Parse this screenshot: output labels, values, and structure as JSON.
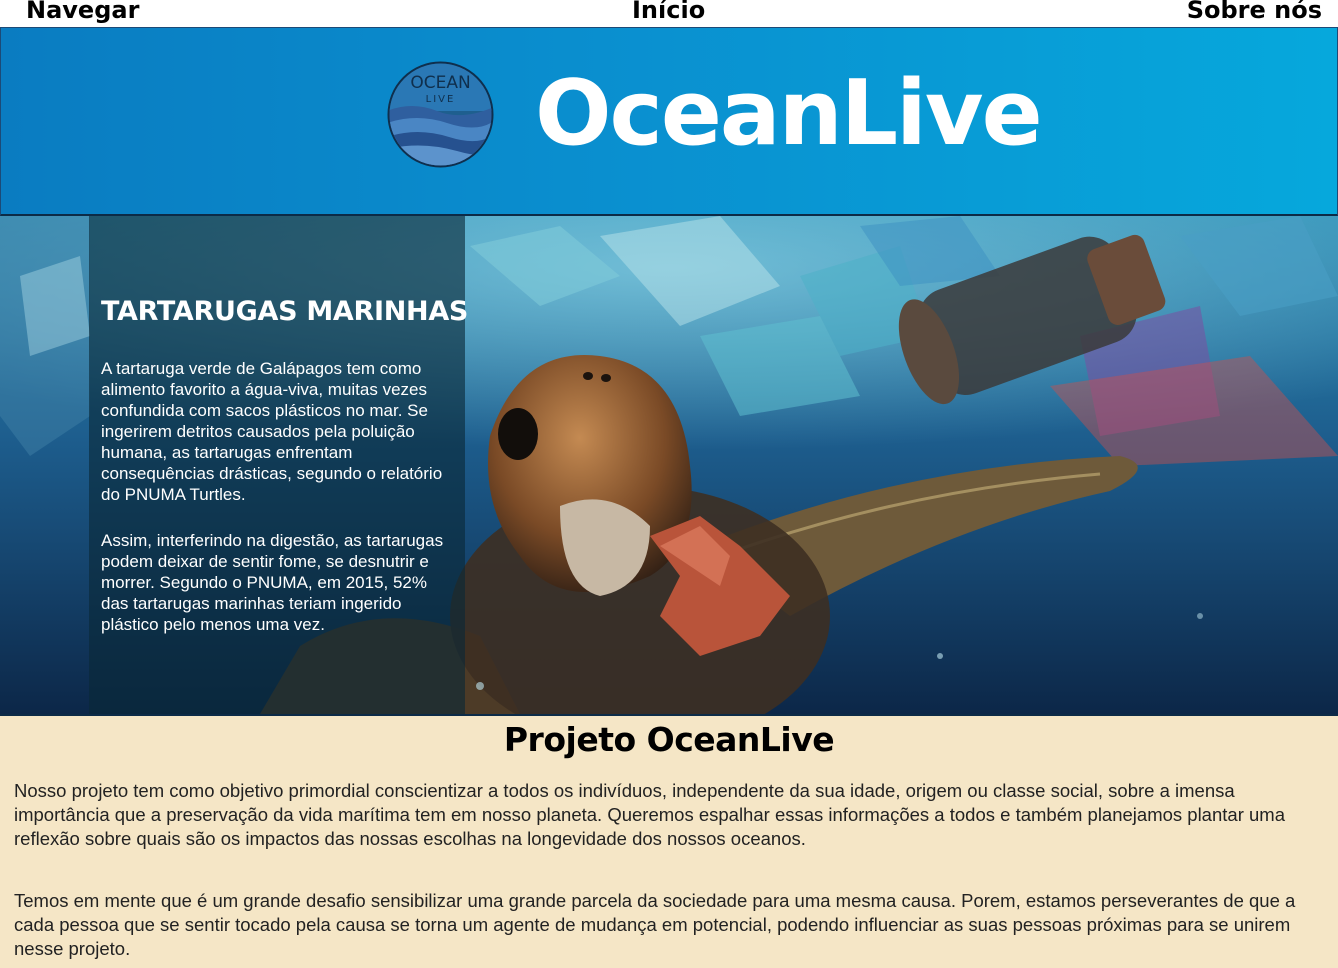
{
  "nav": {
    "items": [
      "Navegar",
      "Início",
      "Sobre nós"
    ]
  },
  "header": {
    "brand": "OceanLive",
    "logo_text_top": "OCEAN",
    "logo_text_bottom": "LIVE"
  },
  "hero": {
    "title": "TARTARUGAS MARINHAS",
    "paragraphs": [
      "A tartaruga verde de Galápagos tem como alimento favorito a água-viva, muitas vezes confundida com sacos plásticos no mar. Se ingerirem detritos causados pela poluição humana, as tartarugas enfrentam consequências drásticas, segundo o relatório do PNUMA Turtles.",
      "Assim, interferindo na digestão, as tartarugas podem deixar de sentir fome, se desnutrir e morrer. Segundo o PNUMA, em 2015, 52% das tartarugas marinhas teriam ingerido plástico pelo menos uma vez."
    ]
  },
  "project": {
    "title": "Projeto OceanLive",
    "paragraphs": [
      "Nosso projeto tem como objetivo primordial conscientizar a todos os indivíduos, independente da sua idade, origem ou classe social, sobre a imensa importância que a preservação da vida marítima tem em nosso planeta. Queremos espalhar essas informações a todos e também planejamos plantar uma reflexão sobre quais são os impactos das nossas escolhas na longevidade dos nossos oceanos.",
      "Temos em mente que é um grande desafio sensibilizar uma grande parcela da sociedade para uma mesma causa. Porem, estamos perseverantes de que a cada pessoa que se sentir tocado pela causa se torna um agente de mudança em potencial, podendo influenciar as suas pessoas próximas para se unirem nesse projeto."
    ]
  },
  "colors": {
    "header_start": "#0a7cc1",
    "header_end": "#06a8dc",
    "project_bg": "#f5e6c6"
  }
}
